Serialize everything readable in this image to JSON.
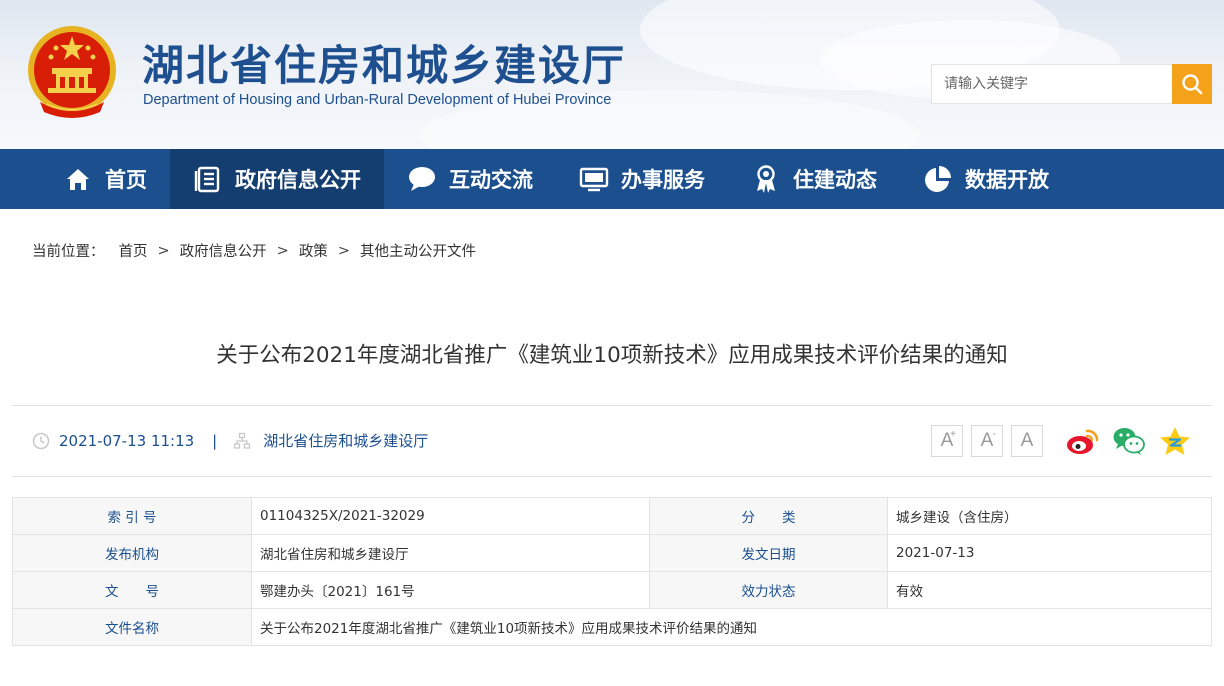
{
  "header": {
    "title": "湖北省住房和城乡建设厅",
    "subtitle": "Department of Housing and Urban-Rural Development of Hubei Province",
    "search_placeholder": "请输入关键字"
  },
  "nav": [
    {
      "label": "首页",
      "icon": "home-icon"
    },
    {
      "label": "政府信息公开",
      "icon": "document-list-icon"
    },
    {
      "label": "互动交流",
      "icon": "chat-bubble-icon"
    },
    {
      "label": "办事服务",
      "icon": "monitor-icon"
    },
    {
      "label": "住建动态",
      "icon": "award-icon"
    },
    {
      "label": "数据开放",
      "icon": "pie-chart-icon"
    }
  ],
  "breadcrumb": {
    "prefix": "当前位置：",
    "items": [
      "首页",
      "政府信息公开",
      "政策",
      "其他主动公开文件"
    ],
    "separator": ">"
  },
  "article": {
    "title": "关于公布2021年度湖北省推广《建筑业10项新技术》应用成果技术评价结果的通知",
    "datetime": "2021-07-13 11:13",
    "meta_separator": "|",
    "source": "湖北省住房和城乡建设厅"
  },
  "font_buttons": [
    "A",
    "A",
    "A"
  ],
  "font_button_marks": [
    "+",
    "-"
  ],
  "share": [
    "weibo-icon",
    "wechat-icon",
    "qzone-icon"
  ],
  "info_table": {
    "rows": [
      {
        "k1": "索 引 号",
        "v1": "01104325X/2021-32029",
        "k2": "分　　类",
        "v2": "城乡建设（含住房）"
      },
      {
        "k1": "发布机构",
        "v1": "湖北省住房和城乡建设厅",
        "k2": "发文日期",
        "v2": "2021-07-13"
      },
      {
        "k1": "文　　号",
        "v1": "鄂建办头〔2021〕161号",
        "k2": "效力状态",
        "v2": "有效"
      }
    ],
    "name_row": {
      "k": "文件名称",
      "v": "关于公布2021年度湖北省推广《建筑业10项新技术》应用成果技术评价结果的通知"
    }
  },
  "colors": {
    "nav": "#1b4f8e",
    "nav_active": "#143d70",
    "accent": "#f5a21b",
    "link": "#1b4f8e"
  }
}
